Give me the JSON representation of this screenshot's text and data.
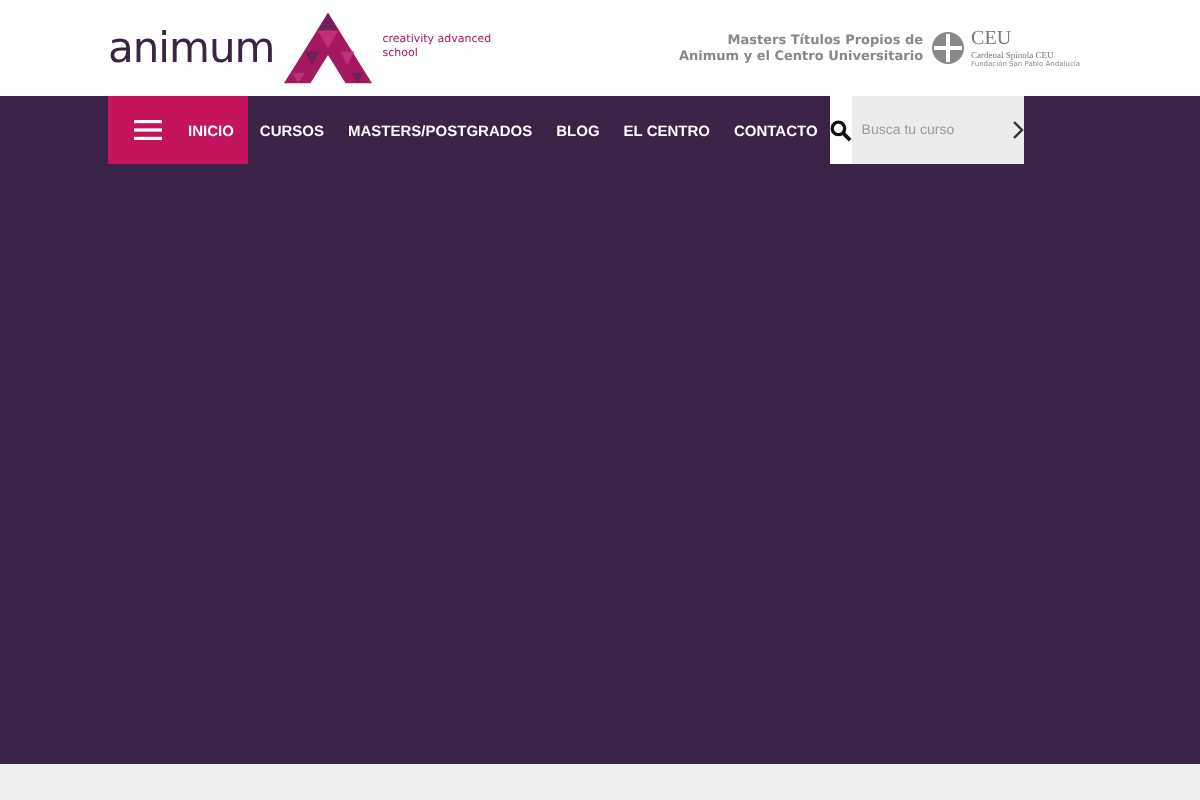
{
  "header": {
    "logo": {
      "name": "animum",
      "tagline": "creativity advanced school"
    },
    "partner": {
      "text": "Masters Títulos Propios de Animum y el Centro Universitario",
      "logo_name": "CEU",
      "logo_sub": "Cardenal Spínola CEU",
      "logo_foot": "Fundación San Pablo Andalucía"
    }
  },
  "nav": {
    "items": [
      {
        "label": "INICIO",
        "selected": true
      },
      {
        "label": "CURSOS",
        "selected": false
      },
      {
        "label": "MASTERS/POSTGRADOS",
        "selected": false
      },
      {
        "label": "BLOG",
        "selected": false
      },
      {
        "label": "EL CENTRO",
        "selected": false
      },
      {
        "label": "CONTACTO",
        "selected": false
      }
    ],
    "search": {
      "placeholder": "Busca tu curso"
    }
  }
}
